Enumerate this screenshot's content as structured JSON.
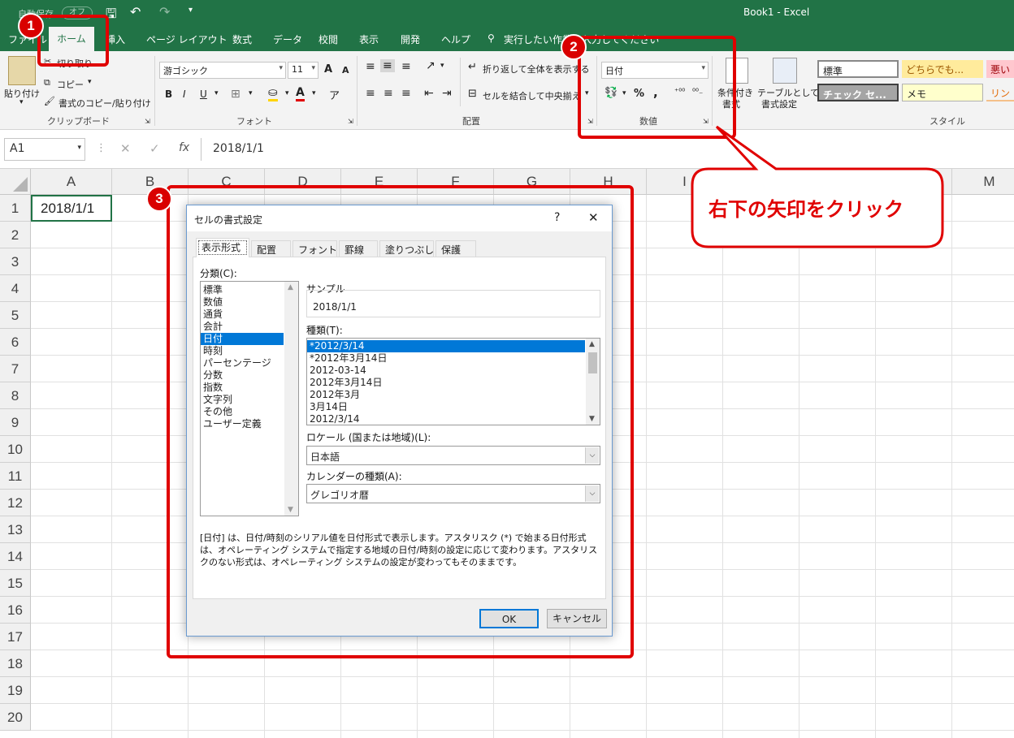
{
  "app": {
    "window_title": "Book1 - Excel",
    "autosave_label": "自動保存",
    "autosave_state": "オフ"
  },
  "ribbon_tabs": {
    "file": "ファイル",
    "home": "ホーム",
    "insert": "挿入",
    "page_layout": "ページ レイアウト",
    "formulas": "数式",
    "data": "データ",
    "review": "校閲",
    "view": "表示",
    "developer": "開発",
    "help": "ヘルプ",
    "tell_me": "実行したい作業を入力してください"
  },
  "clipboard": {
    "paste": "貼り付け",
    "cut": "切り取り",
    "copy": "コピー",
    "format_painter": "書式のコピー/貼り付け",
    "group_label": "クリップボード"
  },
  "font": {
    "font_name": "游ゴシック",
    "font_size": "11",
    "bold": "B",
    "italic": "I",
    "underline": "U",
    "grow": "A",
    "shrink": "A",
    "group_label": "フォント"
  },
  "alignment": {
    "wrap_text": "折り返して全体を表示する",
    "merge_center": "セルを結合して中央揃え",
    "group_label": "配置"
  },
  "number": {
    "format": "日付",
    "percent": "%",
    "comma": ",",
    "group_label": "数値"
  },
  "styles": {
    "conditional_formatting_line1": "条件付き",
    "conditional_formatting_line2": "書式",
    "format_as_table_line1": "テーブルとして",
    "format_as_table_line2": "書式設定",
    "normal": "標準",
    "neutral": "どちらでも...",
    "bad": "悪い",
    "check_cell": "チェック セ...",
    "note": "メモ",
    "link": "リン",
    "group_label": "スタイル"
  },
  "formula_bar": {
    "name_box": "A1",
    "cancel": "✕",
    "enter": "✓",
    "fx": "fx",
    "content": "2018/1/1"
  },
  "grid": {
    "columns": [
      "A",
      "B",
      "C",
      "D",
      "E",
      "F",
      "G",
      "H",
      "I",
      "J",
      "K",
      "L",
      "M"
    ],
    "rows": [
      "1",
      "2",
      "3",
      "4",
      "5",
      "6",
      "7",
      "8",
      "9",
      "10",
      "11",
      "12",
      "13",
      "14",
      "15",
      "16",
      "17",
      "18",
      "19",
      "20"
    ],
    "cell_a1": "2018/1/1"
  },
  "dialog": {
    "title": "セルの書式設定",
    "help": "?",
    "close": "✕",
    "tabs": [
      "表示形式",
      "配置",
      "フォント",
      "罫線",
      "塗りつぶし",
      "保護"
    ],
    "category_label": "分類(C):",
    "categories": [
      "標準",
      "数値",
      "通貨",
      "会計",
      "日付",
      "時刻",
      "パーセンテージ",
      "分数",
      "指数",
      "文字列",
      "その他",
      "ユーザー定義"
    ],
    "selected_category": "日付",
    "sample_label": "サンプル",
    "sample_value": "2018/1/1",
    "type_label": "種類(T):",
    "types": [
      "*2012/3/14",
      "*2012年3月14日",
      "2012-03-14",
      "2012年3月14日",
      "2012年3月",
      "3月14日",
      "2012/3/14"
    ],
    "selected_type": "*2012/3/14",
    "locale_label": "ロケール (国または地域)(L):",
    "locale_value": "日本語",
    "calendar_label": "カレンダーの種類(A):",
    "calendar_value": "グレゴリオ暦",
    "description": "[日付] は、日付/時刻のシリアル値を日付形式で表示します。アスタリスク (*) で始まる日付形式は、オペレーティング システムで指定する地域の日付/時刻の設定に応じて変わります。アスタリスクのない形式は、オペレーティング システムの設定が変わってもそのままです。",
    "ok": "OK",
    "cancel": "キャンセル"
  },
  "annotations": {
    "badge1": "1",
    "badge2": "2",
    "badge3": "3",
    "callout": "右下の矢印をクリック",
    "color": "#e00000"
  }
}
